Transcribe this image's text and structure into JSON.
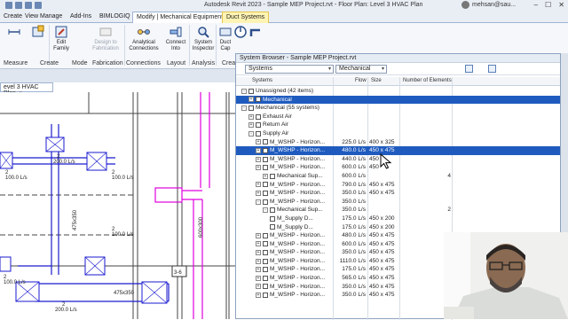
{
  "window": {
    "title": "Autodesk Revit 2023 - Sample MEP Project.rvt - Floor Plan: Level 3 HVAC Plan",
    "user": "mehsan@sau...",
    "min": "–",
    "max": "☐",
    "close": "✕"
  },
  "tabs": [
    "Create",
    "View",
    "Manage",
    "Add-Ins",
    "BIMLOGIQ",
    "Modify | Mechanical Equipment",
    "Duct Systems"
  ],
  "ribbon": {
    "buttons": [
      {
        "label": "Measure"
      },
      {
        "label": "Create"
      },
      {
        "label": "Edit\nFamily"
      },
      {
        "label": "Design to\nFabrication"
      },
      {
        "label": "Analytical\nConnections"
      },
      {
        "label": "Connect\nInto"
      },
      {
        "label": "System\nInspector"
      },
      {
        "label": "Duct\nCap"
      },
      {
        "label": "Power"
      },
      {
        "label": "Piping"
      }
    ],
    "panels": [
      "Measure",
      "Create",
      "Mode",
      "Fabrication",
      "Connections",
      "Layout",
      "Analysis",
      "Crea"
    ]
  },
  "view_tab": {
    "label": "evel 3 HVAC Plan",
    "close": "×"
  },
  "drawing": {
    "labels": {
      "a": "2",
      "b": "200.0 L/s",
      "c": "2",
      "d": "100.0 L/s",
      "e": "2",
      "f": "100.0 L/s",
      "g": "475x350",
      "h": "2",
      "i": "100.0 L/s",
      "j": "475x350",
      "k": "2",
      "l": "200.0 L/s",
      "m": "600x300",
      "n": "3-6",
      "o": "2",
      "p": "100.0 L/s"
    }
  },
  "system_browser": {
    "title": "System Browser - Sample MEP Project.rvt",
    "view_dropdown": "Systems",
    "discipline_dropdown": "Mechanical",
    "columns": [
      "Systems",
      "Flow",
      "Size",
      "Number of Elements"
    ],
    "rows": [
      {
        "indent": 0,
        "pm": "-",
        "name": "Unassigned (42 items)",
        "flow": "",
        "size": "",
        "num": "",
        "sel": false
      },
      {
        "indent": 1,
        "pm": "+",
        "name": "Mechanical",
        "flow": "",
        "size": "",
        "num": "",
        "sel": true
      },
      {
        "indent": 0,
        "pm": "-",
        "name": "Mechanical (55 systems)",
        "flow": "",
        "size": "",
        "num": "",
        "sel": false
      },
      {
        "indent": 1,
        "pm": "+",
        "name": "Exhaust Air",
        "flow": "",
        "size": "",
        "num": "",
        "sel": false
      },
      {
        "indent": 1,
        "pm": "+",
        "name": "Return Air",
        "flow": "",
        "size": "",
        "num": "",
        "sel": false
      },
      {
        "indent": 1,
        "pm": "-",
        "name": "Supply Air",
        "flow": "",
        "size": "",
        "num": "",
        "sel": false
      },
      {
        "indent": 2,
        "pm": "+",
        "name": "M_WSHP - Horizon...",
        "flow": "225.0 L/s",
        "size": "400 x 325",
        "num": "",
        "sel": false
      },
      {
        "indent": 2,
        "pm": "+",
        "name": "M_WSHP - Horizon...",
        "flow": "480.0 L/s",
        "size": "450 x 475",
        "num": "",
        "sel": true
      },
      {
        "indent": 2,
        "pm": "+",
        "name": "M_WSHP - Horizon...",
        "flow": "440.0 L/s",
        "size": "450",
        "num": "",
        "sel": false
      },
      {
        "indent": 2,
        "pm": "+",
        "name": "M_WSHP - Horizon...",
        "flow": "600.0 L/s",
        "size": "450",
        "num": "",
        "sel": false
      },
      {
        "indent": 3,
        "pm": "+",
        "name": "Mechanical Sup...",
        "flow": "600.0 L/s",
        "size": "",
        "num": "4",
        "sel": false
      },
      {
        "indent": 2,
        "pm": "+",
        "name": "M_WSHP - Horizon...",
        "flow": "790.0 L/s",
        "size": "450 x 475",
        "num": "",
        "sel": false
      },
      {
        "indent": 2,
        "pm": "+",
        "name": "M_WSHP - Horizon...",
        "flow": "350.0 L/s",
        "size": "450 x 475",
        "num": "",
        "sel": false
      },
      {
        "indent": 2,
        "pm": "-",
        "name": "M_WSHP - Horizon...",
        "flow": "350.0 L/s",
        "size": "",
        "num": "",
        "sel": false
      },
      {
        "indent": 3,
        "pm": "-",
        "name": "Mechanical Sup...",
        "flow": "350.0 L/s",
        "size": "",
        "num": "2",
        "sel": false
      },
      {
        "indent": 4,
        "pm": "",
        "name": "M_Supply D...",
        "flow": "175.0 L/s",
        "size": "450 x 200",
        "num": "",
        "sel": false
      },
      {
        "indent": 4,
        "pm": "",
        "name": "M_Supply D...",
        "flow": "175.0 L/s",
        "size": "450 x 200",
        "num": "",
        "sel": false
      },
      {
        "indent": 2,
        "pm": "+",
        "name": "M_WSHP - Horizon...",
        "flow": "480.0 L/s",
        "size": "450 x 475",
        "num": "",
        "sel": false
      },
      {
        "indent": 2,
        "pm": "+",
        "name": "M_WSHP - Horizon...",
        "flow": "600.0 L/s",
        "size": "450 x 475",
        "num": "",
        "sel": false
      },
      {
        "indent": 2,
        "pm": "+",
        "name": "M_WSHP - Horizon...",
        "flow": "350.0 L/s",
        "size": "450 x 475",
        "num": "",
        "sel": false
      },
      {
        "indent": 2,
        "pm": "+",
        "name": "M_WSHP - Horizon...",
        "flow": "1110.0 L/s",
        "size": "450 x 475",
        "num": "",
        "sel": false
      },
      {
        "indent": 2,
        "pm": "+",
        "name": "M_WSHP - Horizon...",
        "flow": "175.0 L/s",
        "size": "450 x 475",
        "num": "",
        "sel": false
      },
      {
        "indent": 2,
        "pm": "+",
        "name": "M_WSHP - Horizon...",
        "flow": "565.0 L/s",
        "size": "450 x 475",
        "num": "",
        "sel": false
      },
      {
        "indent": 2,
        "pm": "+",
        "name": "M_WSHP - Horizon...",
        "flow": "350.0 L/s",
        "size": "450 x 475",
        "num": "",
        "sel": false
      },
      {
        "indent": 2,
        "pm": "+",
        "name": "M_WSHP - Horizon...",
        "flow": "350.0 L/s",
        "size": "450 x 475",
        "num": "",
        "sel": false
      }
    ]
  },
  "colors": {
    "accent": "#1f5bbf",
    "duct_blue": "#1a1ad0",
    "duct_magenta": "#e000e0",
    "ribbon_bg": "#f5f7fb"
  }
}
